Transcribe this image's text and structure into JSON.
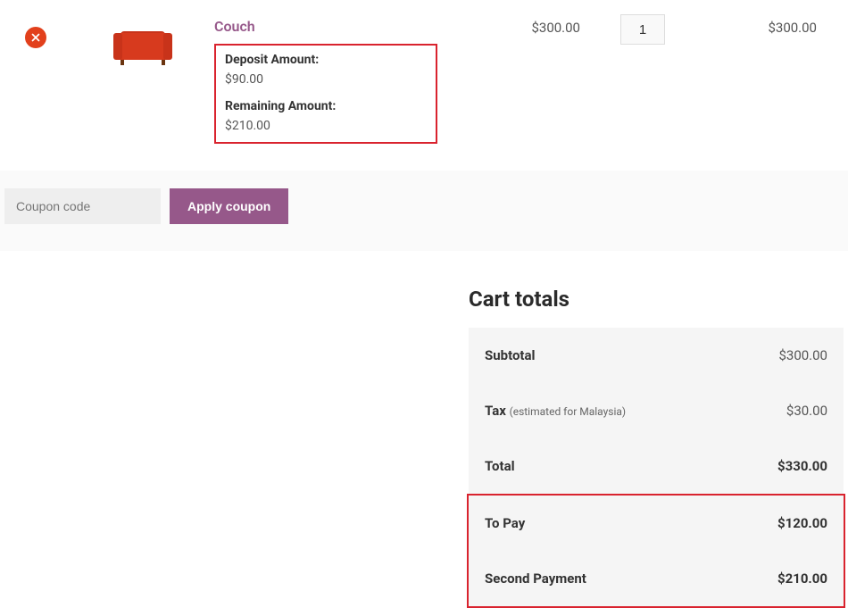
{
  "product": {
    "name": "Couch",
    "price": "$300.00",
    "quantity": "1",
    "subtotal": "$300.00",
    "deposit": {
      "label": "Deposit Amount:",
      "value": "$90.00"
    },
    "remaining": {
      "label": "Remaining Amount:",
      "value": "$210.00"
    }
  },
  "coupon": {
    "placeholder": "Coupon code",
    "button": "Apply coupon"
  },
  "totals": {
    "title": "Cart totals",
    "rows": {
      "subtotal": {
        "label": "Subtotal",
        "value": "$300.00"
      },
      "tax": {
        "label": "Tax",
        "sub": "(estimated for Malaysia)",
        "value": "$30.00"
      },
      "total": {
        "label": "Total",
        "value": "$330.00"
      },
      "to_pay": {
        "label": "To Pay",
        "value": "$120.00"
      },
      "second": {
        "label": "Second Payment",
        "value": "$210.00"
      }
    }
  }
}
